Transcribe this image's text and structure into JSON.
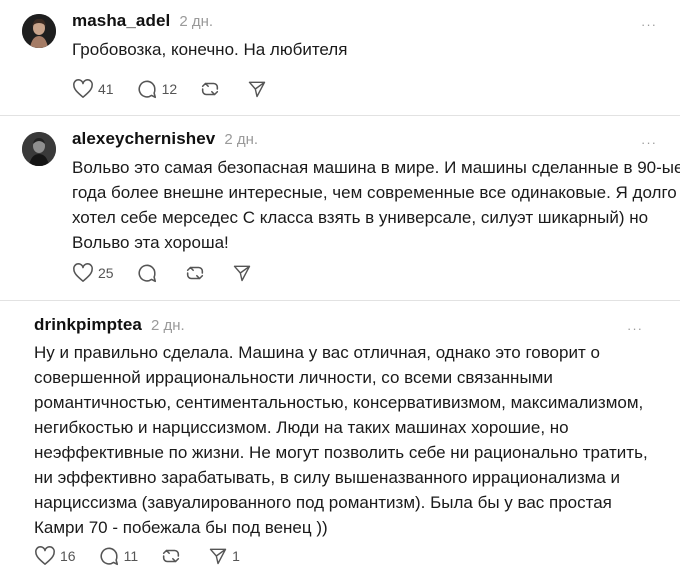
{
  "comments": [
    {
      "username": "masha_adel",
      "time": "2 дн.",
      "more": "···",
      "lines": [
        "Гробовозка, конечно. На любителя"
      ],
      "likes": "41",
      "replies": "12",
      "reposts": "",
      "shares": ""
    },
    {
      "username": "alexeychernishev",
      "time": "2 дн.",
      "more": "···",
      "lines": [
        "Вольво это самая безопасная машина в мире. И машины сделанные в 90-ые",
        "года более внешне интересные, чем современные все одинаковые. Я долго",
        "хотел себе мерседес С класса взять в универсале, силуэт шикарный) но",
        "Вольво эта хороша!"
      ],
      "likes": "25",
      "replies": "",
      "reposts": "",
      "shares": ""
    },
    {
      "username": "drinkpimptea",
      "time": "2 дн.",
      "more": "···",
      "lines": [
        "Ну и правильно сделала. Машина у вас отличная, однако это говорит о",
        "совершенной иррациональности личности, со всеми связанными",
        "романтичностью, сентиментальностью, консервативизмом, максимализмом,",
        "негибкостью и нарциссизмом. Люди на таких машинах хорошие, но",
        "неэффективные по жизни. Не могут позволить себе ни рационально тратить,",
        "ни эффективно зарабатывать, в силу вышеназванного иррационализма и",
        "нарциссизма (завуалированного под романтизм). Была бы у вас простая",
        "Камри 70 - побежала бы под венец ))"
      ],
      "likes": "16",
      "replies": "11",
      "reposts": "",
      "shares": "1"
    }
  ],
  "icons": {
    "avatar": "avatar-photo",
    "like": "heart-icon",
    "reply": "speech-bubble-icon",
    "repost": "repost-arrows-icon",
    "share": "paper-plane-icon",
    "more": "more-dots-icon"
  },
  "colors": {
    "text": "#1a1a1a",
    "muted": "#9a9a9a",
    "divider": "#e2e2e2",
    "icon": "#555555"
  }
}
